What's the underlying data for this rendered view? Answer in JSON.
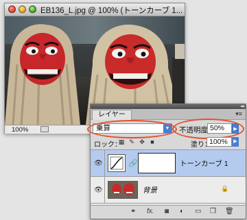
{
  "document": {
    "title": "EB136_L.jpg @ 100% (トーンカーブ 1...",
    "zoom": "100%"
  },
  "layers_panel": {
    "tab_label": "レイヤー",
    "blend_mode": "乗算",
    "opacity_label": "不透明度：",
    "opacity_value": "50%",
    "lock_label": "ロック：",
    "fill_label": "塗り：",
    "fill_value": "100%",
    "layers": [
      {
        "name": "トーンカーブ 1",
        "type": "adjustment",
        "selected": true
      },
      {
        "name": "背景",
        "type": "background",
        "locked": true
      }
    ],
    "footer_icons": [
      "link-icon",
      "fx-icon",
      "mask-icon",
      "adjustment-icon",
      "folder-icon",
      "new-layer-icon",
      "trash-icon"
    ]
  },
  "colors": {
    "highlight_ring": "#e5502c",
    "selected_row": "#b4cbef",
    "accent_blue": "#4a7fd0"
  }
}
